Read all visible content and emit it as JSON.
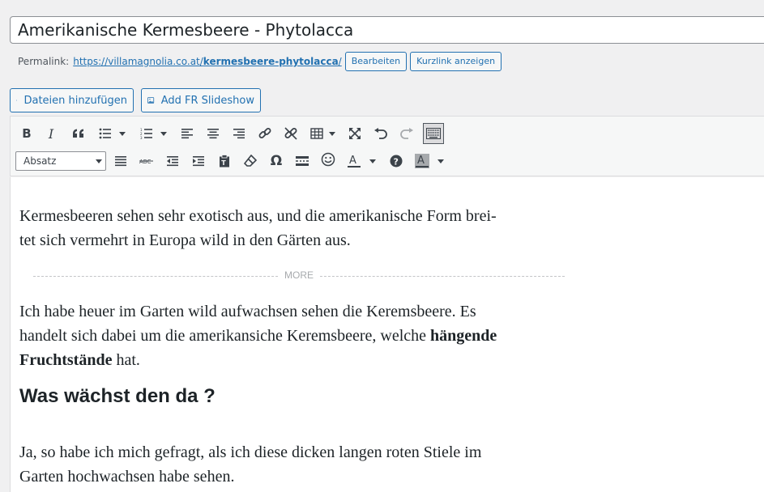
{
  "post": {
    "title": "Amerikanische Kermesbeere - Phytolacca"
  },
  "permalink": {
    "label": "Permalink:",
    "url_base": "https://villamagnolia.co.at/",
    "url_slug": "kermesbeere-phytolacca",
    "url_trail": "/",
    "edit_label": "Bearbeiten",
    "shortlink_label": "Kurzlink anzeigen"
  },
  "media_buttons": {
    "add_media": "Dateien hinzufügen",
    "add_slideshow": "Add FR Slideshow"
  },
  "toolbar": {
    "format_select": "Absatz",
    "row1": [
      "bold-icon",
      "italic-icon",
      "blockquote-icon",
      "bullet-list-icon",
      "numbered-list-icon",
      "align-left-icon",
      "align-center-icon",
      "align-right-icon",
      "link-icon",
      "unlink-icon",
      "table-icon",
      "fullscreen-icon",
      "undo-icon",
      "redo-icon",
      "toolbar-toggle-icon"
    ],
    "row2": [
      "justify-icon",
      "strikethrough-icon",
      "outdent-icon",
      "indent-icon",
      "paste-text-icon",
      "clear-format-icon",
      "omega-icon",
      "read-more-icon",
      "emoticon-icon",
      "text-color-icon",
      "help-icon",
      "background-color-icon"
    ],
    "accent_color": "#2271b1"
  },
  "content": {
    "p1": "Kermesbeeren sehen sehr exotisch aus, und die amerikanische Form brei-",
    "p1b": "tet sich vermehrt in Europa wild in den Gärten aus.",
    "more_label": "MORE",
    "p2a": "Ich habe heuer im Garten wild aufwachsen sehen die Keremsbeere. Es",
    "p2b": "handelt sich dabei um die amerikansiche Keremsbeere, welche ",
    "p2_bold1": "hängende",
    "p2_bold2": "Fruchtstände",
    "p2c": " hat.",
    "heading": "Was wächst den da ?",
    "p3a": "Ja, so habe ich mich gefragt, als ich diese dicken langen roten Stiele im",
    "p3b": "Garten hochwachsen habe sehen."
  }
}
